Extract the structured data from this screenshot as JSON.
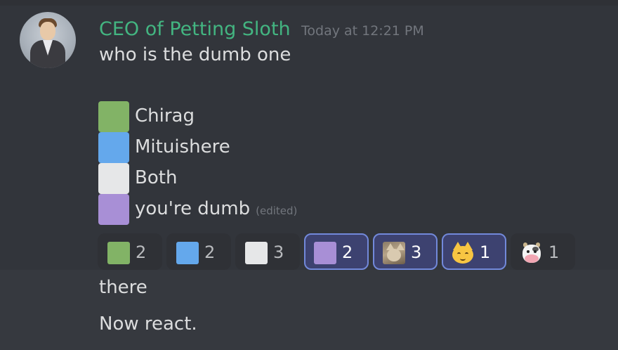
{
  "message": {
    "username": "CEO of Petting Sloth",
    "timestamp": "Today at 12:21 PM",
    "text": "who is the dumb one",
    "options": [
      {
        "label": "Chirag",
        "color": "#82b366"
      },
      {
        "label": "Mituishere",
        "color": "#64a8ec"
      },
      {
        "label": "Both",
        "color": "#e6e7e8"
      },
      {
        "label": "you're dumb",
        "color": "#a88fd6"
      }
    ],
    "edited_label": "(edited)",
    "reactions": [
      {
        "emoji": "green-square",
        "count": "2",
        "me": false
      },
      {
        "emoji": "blue-square",
        "count": "2",
        "me": false
      },
      {
        "emoji": "white-square",
        "count": "3",
        "me": false
      },
      {
        "emoji": "purple-square",
        "count": "2",
        "me": true
      },
      {
        "emoji": "cat-photo",
        "count": "3",
        "me": true
      },
      {
        "emoji": "cat-face",
        "count": "1",
        "me": true
      },
      {
        "emoji": "cow-face",
        "count": "1",
        "me": false
      }
    ]
  },
  "followups": [
    "there",
    "Now react."
  ],
  "colors": {
    "background": "#36393f",
    "highlight": "#32353b",
    "username": "#43b581",
    "reacted_border": "#7289da"
  }
}
